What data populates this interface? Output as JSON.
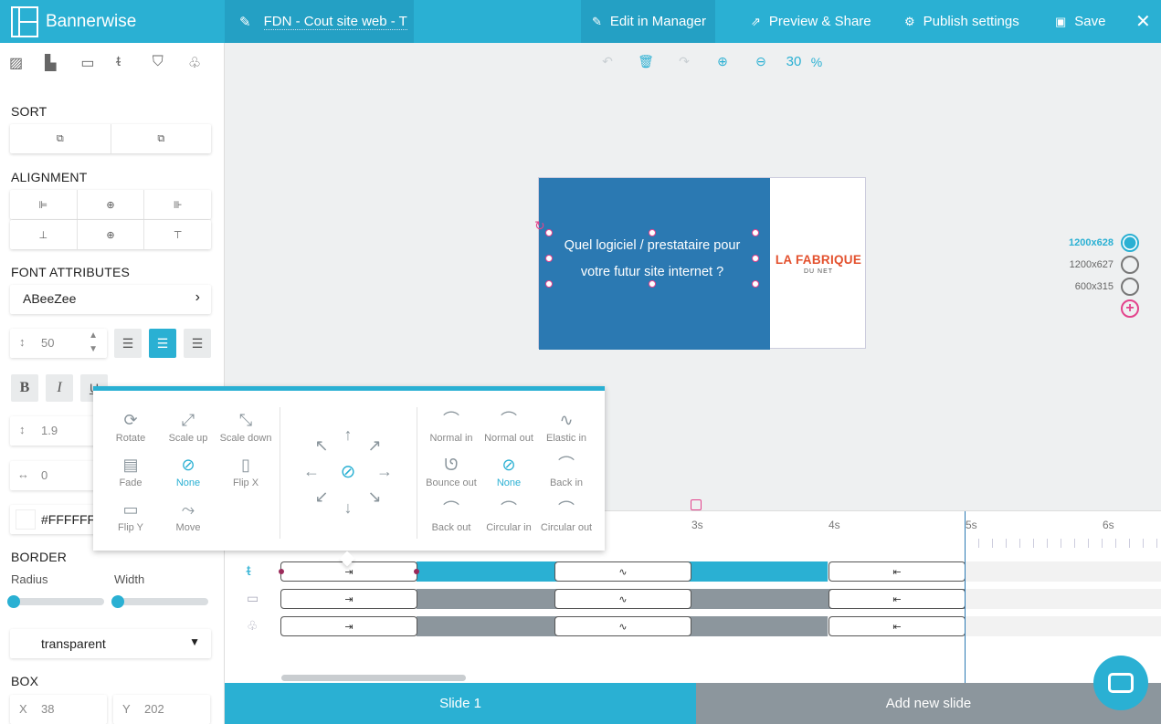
{
  "header": {
    "brand": "Bannerwise",
    "doc_title": "FDN - Cout site web - T",
    "edit_manager": "Edit in Manager",
    "preview_share": "Preview & Share",
    "publish_settings": "Publish settings",
    "save": "Save",
    "close": "✕"
  },
  "sidebar": {
    "tool_icons": [
      "pattern-icon",
      "layout-icon",
      "image-icon",
      "text-icon",
      "button-icon",
      "shapes-icon"
    ],
    "sort_title": "SORT",
    "alignment_title": "ALIGNMENT",
    "font_title": "FONT ATTRIBUTES",
    "font_name": "ABeeZee",
    "font_size": "50",
    "line_height": "1.9",
    "letter_spacing": "0",
    "color_value": "#FFFFFF",
    "border_title": "BORDER",
    "radius_label": "Radius",
    "width_label": "Width",
    "border_style": "transparent",
    "box_title": "BOX",
    "box_x_label": "X",
    "box_x": "38",
    "box_y_label": "Y",
    "box_y": "202"
  },
  "canvas": {
    "zoom": "30",
    "zoom_unit": "%"
  },
  "banner": {
    "text_line1": "Quel logiciel / prestataire pour",
    "text_line2": "votre futur site internet ?",
    "brand_line1": "LA FABRIQUE",
    "brand_line2": "DU NET"
  },
  "sizes": [
    {
      "label": "1200x628",
      "active": true
    },
    {
      "label": "1200x627",
      "active": false
    },
    {
      "label": "600x315",
      "active": false
    }
  ],
  "timeline": {
    "ticks": [
      "3s",
      "4s",
      "5s",
      "6s"
    ]
  },
  "slides": {
    "slide1": "Slide 1",
    "add": "Add new slide"
  },
  "popup": {
    "effects": [
      "Rotate",
      "Scale up",
      "Scale down",
      "Fade",
      "None",
      "Flip X",
      "Flip Y",
      "Move"
    ],
    "easings": [
      "Normal in",
      "Normal out",
      "Elastic in",
      "Bounce out",
      "None",
      "Back in",
      "Back out",
      "Circular in",
      "Circular out"
    ]
  },
  "colors": {
    "accent": "#2ab0d3",
    "selection": "#e3438c",
    "banner_bg": "#2b79b2",
    "brand": "#e3502d"
  }
}
